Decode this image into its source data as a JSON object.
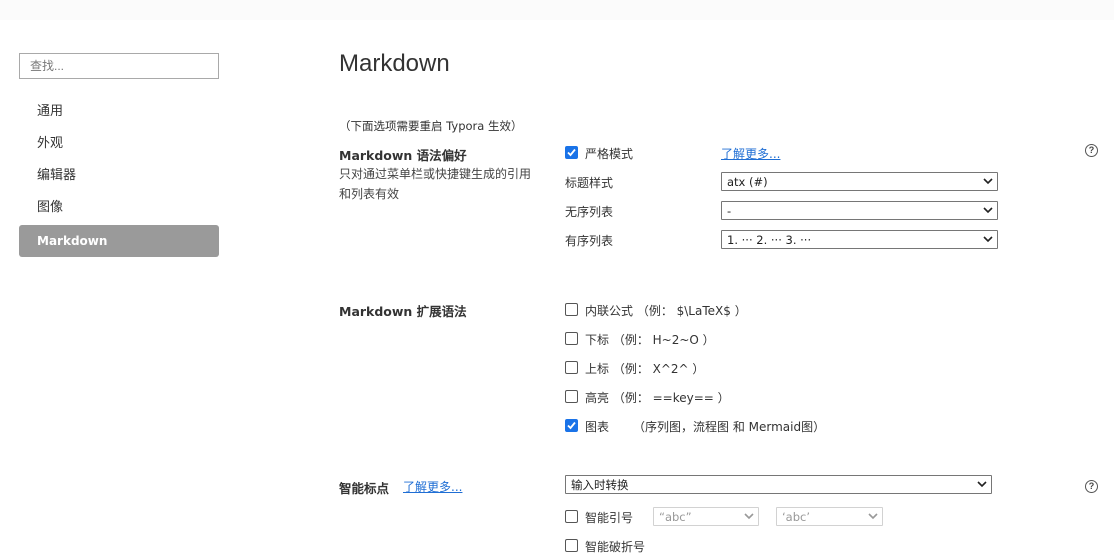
{
  "sidebar": {
    "search_placeholder": "查找...",
    "items": [
      {
        "label": "通用"
      },
      {
        "label": "外观"
      },
      {
        "label": "编辑器"
      },
      {
        "label": "图像"
      },
      {
        "label": "Markdown",
        "active": true
      }
    ]
  },
  "main": {
    "title": "Markdown",
    "restart_note": "（下面选项需要重启 Typora 生效）",
    "syntax_pref": {
      "title": "Markdown 语法偏好",
      "description": [
        "只对通过菜单栏或快捷键生成的引用",
        "和列表有效"
      ],
      "strict_mode": {
        "label": "严格模式",
        "checked": true
      },
      "learn_more": "了解更多...",
      "heading_style": {
        "label": "标题样式",
        "value": "atx (#)"
      },
      "unordered_list": {
        "label": "无序列表",
        "value": "-"
      },
      "ordered_list": {
        "label": "有序列表",
        "value": "1. ··· 2. ··· 3. ···"
      }
    },
    "extended_syntax": {
      "title": "Markdown 扩展语法",
      "options": [
        {
          "label": "内联公式 （例： $\\LaTeX$ ）",
          "checked": false
        },
        {
          "label": "下标 （例： H~2~O ）",
          "checked": false
        },
        {
          "label": "上标 （例： X^2^ ）",
          "checked": false
        },
        {
          "label": "高亮 （例： ==key== ）",
          "checked": false
        },
        {
          "label": "图表",
          "note": "（序列图，流程图 和 Mermaid图）",
          "checked": true
        }
      ]
    },
    "smart_punct": {
      "title": "智能标点",
      "learn_more": "了解更多...",
      "mode_value": "输入时转换",
      "smart_quotes": {
        "label": "智能引号",
        "checked": false,
        "double_value": "“abc”",
        "single_value": "‘abc’"
      },
      "smart_dashes": {
        "label": "智能破折号",
        "checked": false
      }
    }
  },
  "colors": {
    "accent": "#1a73e8",
    "active_nav": "#9a9a9a",
    "link": "#1f6ed4"
  }
}
